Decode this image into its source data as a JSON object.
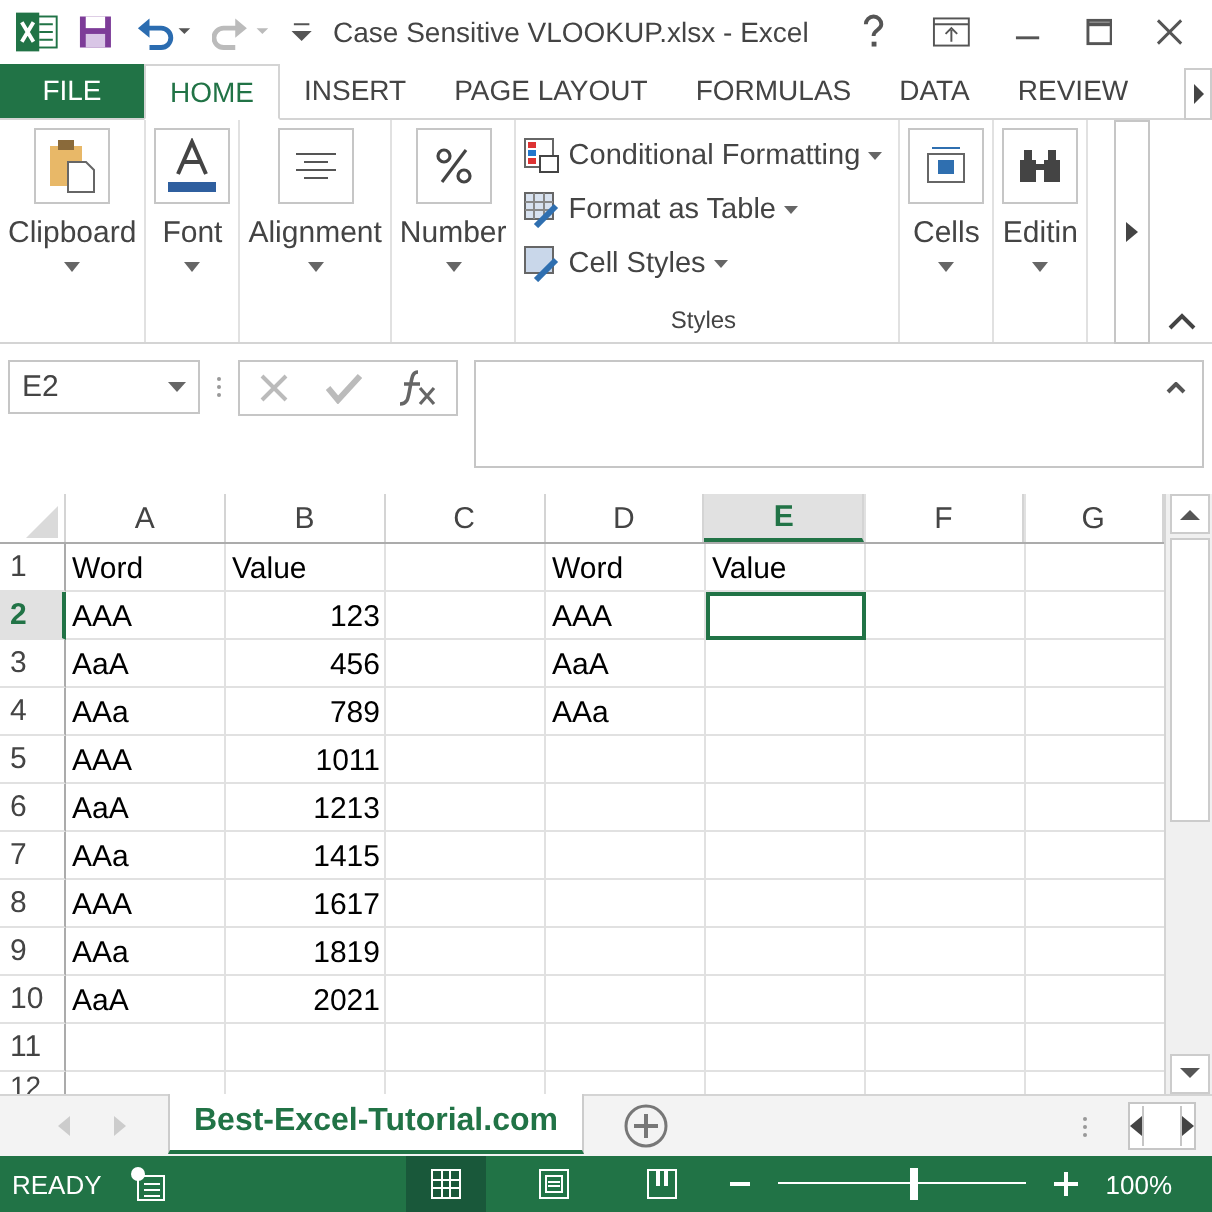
{
  "window": {
    "title": "Case Sensitive VLOOKUP.xlsx - Excel"
  },
  "tabs": [
    {
      "label": "FILE",
      "kind": "file",
      "selected": false
    },
    {
      "label": "HOME",
      "kind": "tab",
      "selected": true
    },
    {
      "label": "INSERT",
      "kind": "tab",
      "selected": false
    },
    {
      "label": "PAGE LAYOUT",
      "kind": "tab",
      "selected": false
    },
    {
      "label": "FORMULAS",
      "kind": "tab",
      "selected": false
    },
    {
      "label": "DATA",
      "kind": "tab",
      "selected": false
    },
    {
      "label": "REVIEW",
      "kind": "tab",
      "selected": false
    }
  ],
  "ribbon": {
    "left_groups": [
      {
        "label": "Clipboard",
        "kind": "clipboard"
      },
      {
        "label": "Font",
        "kind": "font"
      },
      {
        "label": "Alignment",
        "kind": "alignment"
      },
      {
        "label": "Number",
        "kind": "number"
      }
    ],
    "styles": {
      "label": "Styles",
      "commands": [
        {
          "label": "Conditional Formatting",
          "kind": "conditional"
        },
        {
          "label": "Format as Table",
          "kind": "table"
        },
        {
          "label": "Cell Styles",
          "kind": "styles"
        }
      ]
    },
    "right_groups": [
      {
        "label": "Cells",
        "kind": "cells"
      },
      {
        "label": "Editin",
        "kind": "editing"
      }
    ]
  },
  "name_box": "E2",
  "columns": [
    {
      "label": "A",
      "selected": false
    },
    {
      "label": "B",
      "selected": false
    },
    {
      "label": "C",
      "selected": false
    },
    {
      "label": "D",
      "selected": false
    },
    {
      "label": "E",
      "selected": true
    },
    {
      "label": "F",
      "selected": false
    },
    {
      "label": "G",
      "selected": false
    }
  ],
  "rows": [
    {
      "header": "1",
      "selected": false,
      "cells": [
        {
          "text": "Word",
          "kind": "text"
        },
        {
          "text": "Value",
          "kind": "text"
        },
        {
          "kind": "empty"
        },
        {
          "text": "Word",
          "kind": "text"
        },
        {
          "text": "Value",
          "kind": "text"
        }
      ]
    },
    {
      "header": "2",
      "selected": true,
      "cells": [
        {
          "text": "AAA",
          "kind": "text"
        },
        {
          "text": "123",
          "kind": "number"
        },
        {
          "kind": "empty"
        },
        {
          "text": "AAA",
          "kind": "text"
        }
      ]
    },
    {
      "header": "3",
      "selected": false,
      "cells": [
        {
          "text": "AaA",
          "kind": "text"
        },
        {
          "text": "456",
          "kind": "number"
        },
        {
          "kind": "empty"
        },
        {
          "text": "AaA",
          "kind": "text"
        }
      ]
    },
    {
      "header": "4",
      "selected": false,
      "cells": [
        {
          "text": "AAa",
          "kind": "text"
        },
        {
          "text": "789",
          "kind": "number"
        },
        {
          "kind": "empty"
        },
        {
          "text": "AAa",
          "kind": "text"
        }
      ]
    },
    {
      "header": "5",
      "selected": false,
      "cells": [
        {
          "text": "AAA",
          "kind": "text"
        },
        {
          "text": "1011",
          "kind": "number"
        }
      ]
    },
    {
      "header": "6",
      "selected": false,
      "cells": [
        {
          "text": "AaA",
          "kind": "text"
        },
        {
          "text": "1213",
          "kind": "number"
        }
      ]
    },
    {
      "header": "7",
      "selected": false,
      "cells": [
        {
          "text": "AAa",
          "kind": "text"
        },
        {
          "text": "1415",
          "kind": "number"
        }
      ]
    },
    {
      "header": "8",
      "selected": false,
      "cells": [
        {
          "text": "AAA",
          "kind": "text"
        },
        {
          "text": "1617",
          "kind": "number"
        }
      ]
    },
    {
      "header": "9",
      "selected": false,
      "cells": [
        {
          "text": "AAa",
          "kind": "text"
        },
        {
          "text": "1819",
          "kind": "number"
        }
      ]
    },
    {
      "header": "10",
      "selected": false,
      "cells": [
        {
          "text": "AaA",
          "kind": "text"
        },
        {
          "text": "2021",
          "kind": "number"
        }
      ]
    },
    {
      "header": "11",
      "selected": false,
      "cells": []
    },
    {
      "header": "12",
      "selected": false,
      "cells": []
    }
  ],
  "sheet_tabs": [
    {
      "label": "Best-Excel-Tutorial.com",
      "selected": true
    }
  ],
  "status_bar": {
    "mode": "READY",
    "level": 0.55,
    "zoom": "100%"
  }
}
